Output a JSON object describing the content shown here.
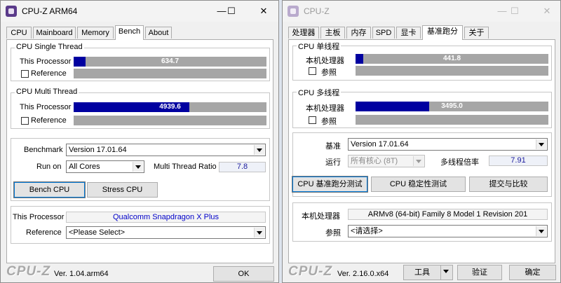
{
  "left": {
    "title": "CPU-Z ARM64",
    "controls": {
      "minimize": "—",
      "maximize": "☐",
      "close": "✕"
    },
    "tabs": [
      "CPU",
      "Mainboard",
      "Memory",
      "Bench",
      "About"
    ],
    "single": {
      "legend": "CPU Single Thread",
      "this_label": "This Processor",
      "this_score": "634.7",
      "this_fraction": 0.06,
      "ref_label": "Reference"
    },
    "multi": {
      "legend": "CPU Multi Thread",
      "this_label": "This Processor",
      "this_score": "4939.6",
      "this_fraction": 0.6,
      "ref_label": "Reference"
    },
    "bench": {
      "benchmark_label": "Benchmark",
      "benchmark_value": "Version 17.01.64",
      "runon_label": "Run on",
      "runon_value": "All Cores",
      "ratio_label": "Multi Thread Ratio",
      "ratio_value": "7.8",
      "bench_btn": "Bench CPU",
      "stress_btn": "Stress CPU"
    },
    "proc": {
      "this_label": "This Processor",
      "this_value": "Qualcomm Snapdragon X Plus",
      "ref_label": "Reference",
      "ref_value": "<Please Select>"
    },
    "footer": {
      "logo": "CPU-Z",
      "version": "Ver. 1.04.arm64",
      "ok": "OK"
    }
  },
  "right": {
    "title": "CPU-Z",
    "controls": {
      "minimize": "—",
      "maximize": "☐",
      "close": "✕"
    },
    "tabs": [
      "处理器",
      "主板",
      "内存",
      "SPD",
      "显卡",
      "基准跑分",
      "关于"
    ],
    "single": {
      "legend": "CPU 单线程",
      "this_label": "本机处理器",
      "this_score": "441.8",
      "this_fraction": 0.04,
      "ref_label": "参照"
    },
    "multi": {
      "legend": "CPU 多线程",
      "this_label": "本机处理器",
      "this_score": "3495.0",
      "this_fraction": 0.38,
      "ref_label": "参照"
    },
    "bench": {
      "benchmark_label": "基准",
      "benchmark_value": "Version 17.01.64",
      "runon_label": "运行",
      "runon_value": "所有核心 (8T)",
      "ratio_label": "多线程倍率",
      "ratio_value": "7.91",
      "bench_btn": "CPU 基准跑分测试",
      "stress_btn": "CPU 稳定性测试",
      "submit_btn": "提交与比较"
    },
    "proc": {
      "this_label": "本机处理器",
      "this_value": "ARMv8 (64-bit) Family 8 Model 1 Revision 201",
      "ref_label": "参照",
      "ref_value": "<请选择>"
    },
    "footer": {
      "logo": "CPU-Z",
      "version": "Ver. 2.16.0.x64",
      "tools": "工具",
      "validate": "验证",
      "ok": "确定"
    }
  }
}
